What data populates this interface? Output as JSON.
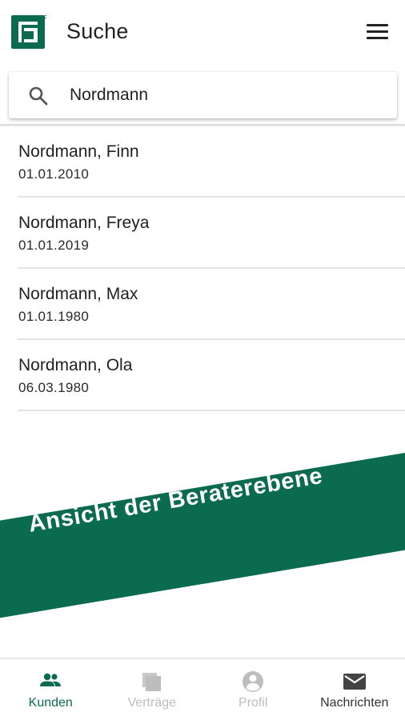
{
  "app_bar": {
    "title": "Suche",
    "icons": {
      "logo": "brand-logo",
      "menu": "hamburger-menu-icon"
    },
    "brand_color": "#0a6b4e"
  },
  "search": {
    "value": "Nordmann",
    "icon": "search-icon"
  },
  "results": [
    {
      "name": "Nordmann, Finn",
      "date": "01.01.2010"
    },
    {
      "name": "Nordmann, Freya",
      "date": "01.01.2019"
    },
    {
      "name": "Nordmann, Max",
      "date": "01.01.1980"
    },
    {
      "name": "Nordmann, Ola",
      "date": "06.03.1980"
    }
  ],
  "banner": {
    "text": "Ansicht der Beraterebene",
    "color": "#0a6b4e"
  },
  "bottom_nav": {
    "items": [
      {
        "label": "Kunden",
        "icon": "people-icon",
        "state": "active"
      },
      {
        "label": "Verträge",
        "icon": "contracts-icon",
        "state": "disabled"
      },
      {
        "label": "Profil",
        "icon": "profile-icon",
        "state": "disabled"
      },
      {
        "label": "Nachrichten",
        "icon": "mail-icon",
        "state": "normal"
      }
    ]
  }
}
